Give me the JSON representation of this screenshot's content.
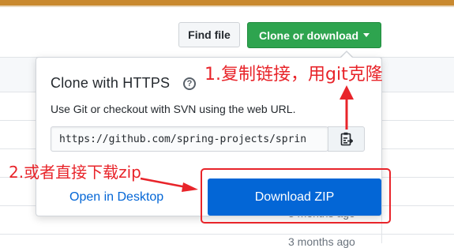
{
  "toolbar": {
    "find_file_label": "Find file",
    "clone_label": "Clone or download"
  },
  "dropdown": {
    "title": "Clone with HTTPS",
    "help_glyph": "?",
    "description": "Use Git or checkout with SVN using the web URL.",
    "url_value": "https://github.com/spring-projects/sprin",
    "copy_icon": "clipboard-icon",
    "open_desktop_label": "Open in Desktop",
    "download_zip_label": "Download ZIP"
  },
  "background": {
    "commit_time_1": "3 months ago",
    "commit_time_2": "3 months ago"
  },
  "annotations": {
    "note_1": "1.复制链接，用git克隆",
    "note_2": "2.或者直接下载zip"
  },
  "colors": {
    "clone_green": "#2ea44f",
    "download_blue": "#0366d6",
    "annotation_red": "#e8242a",
    "top_bar": "#c9892f"
  }
}
